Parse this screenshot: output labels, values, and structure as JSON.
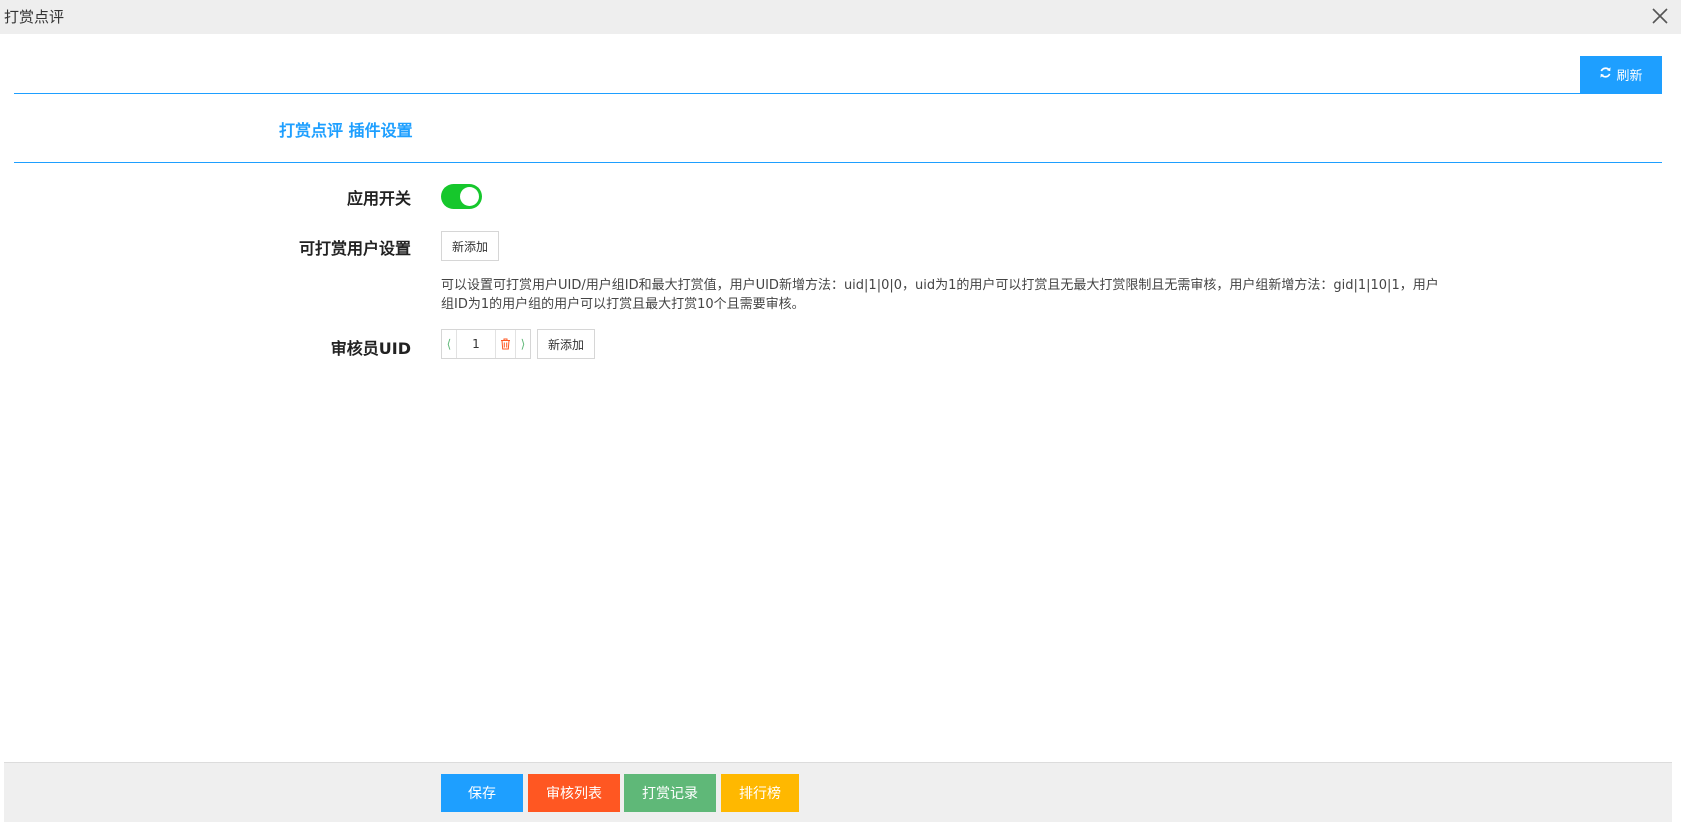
{
  "window": {
    "title": "打赏点评"
  },
  "toolbar": {
    "refresh_label": "刷新"
  },
  "section": {
    "title": "打赏点评 插件设置"
  },
  "form": {
    "app_switch": {
      "label": "应用开关",
      "enabled": true
    },
    "reward_users": {
      "label": "可打赏用户设置",
      "add_label": "新添加",
      "help_line1": "可以设置可打赏用户UID/用户组ID和最大打赏值，用户UID新增方法：uid|1|0|0，uid为1的用户可以打赏且无最大打赏限制且无需审核，用户组新增方法：gid|1|10|1，用户",
      "help_line2": "组ID为1的用户组的用户可以打赏且最大打赏10个且需要审核。"
    },
    "reviewer_uid": {
      "label": "审核员UID",
      "value": "1",
      "prev_glyph": "⟨",
      "next_glyph": "⟩",
      "add_label": "新添加"
    }
  },
  "footer": {
    "save_label": "保存",
    "review_list_label": "审核列表",
    "reward_log_label": "打赏记录",
    "ranking_label": "排行榜"
  },
  "colors": {
    "primary": "#1e9fff",
    "switch_on": "#16c72c",
    "review_list": "#ff5722",
    "reward_log": "#5fb878",
    "ranking": "#ffb800"
  }
}
